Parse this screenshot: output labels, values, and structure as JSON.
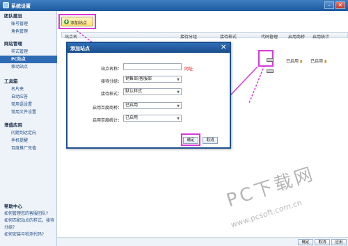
{
  "window": {
    "title": "系统设置"
  },
  "sidebar": {
    "sections": [
      {
        "title": "团队建设",
        "items": [
          "账号管理",
          "角色管理"
        ]
      },
      {
        "title": "网站管理",
        "items": [
          "样式管理",
          "PC站点",
          "移动站点"
        ]
      },
      {
        "title": "工具箱",
        "items": [
          "名片夹",
          "自动应答",
          "常用语设置",
          "常用文件设置"
        ]
      },
      {
        "title": "增值应用",
        "items": [
          "问题到达定向",
          "手机提醒",
          "百度推广充值"
        ]
      }
    ],
    "active_item": "PC站点",
    "help": {
      "title": "帮助中心",
      "links": [
        "如何管理您的客服团队?",
        "如何匹配站点的样式，接待分组?",
        "如何安装与检测代码?"
      ]
    }
  },
  "toolbar": {
    "add_site_label": "添加站点"
  },
  "table": {
    "columns": [
      "站点名",
      "接待分组",
      "接待样式",
      "代码管理",
      "启用商桥",
      "启用统计"
    ],
    "row": {
      "bridge": "已启用",
      "stats": "已启用"
    }
  },
  "bottom_bar": {
    "buttons": [
      "确定",
      "取消",
      "应用"
    ]
  },
  "dialog": {
    "title": "添加站点",
    "fields": [
      {
        "label": "站点名称：",
        "value": ""
      },
      {
        "label": "接待分组：",
        "value": "销售部/客服部"
      },
      {
        "label": "接待样式：",
        "value": "默认样式"
      },
      {
        "label": "启用百度商桥：",
        "value": "已启用"
      },
      {
        "label": "启用百度统计：",
        "value": "已启用"
      }
    ],
    "hint": "网址",
    "ok_label": "确定",
    "cancel_label": "取消"
  },
  "watermark": {
    "text": "PC下载网",
    "url": "www.pcsoft.com.cn"
  },
  "colors": {
    "highlight": "#d63ad6",
    "titlebar": "#2f6db5",
    "active_nav": "#2d6bb5"
  }
}
